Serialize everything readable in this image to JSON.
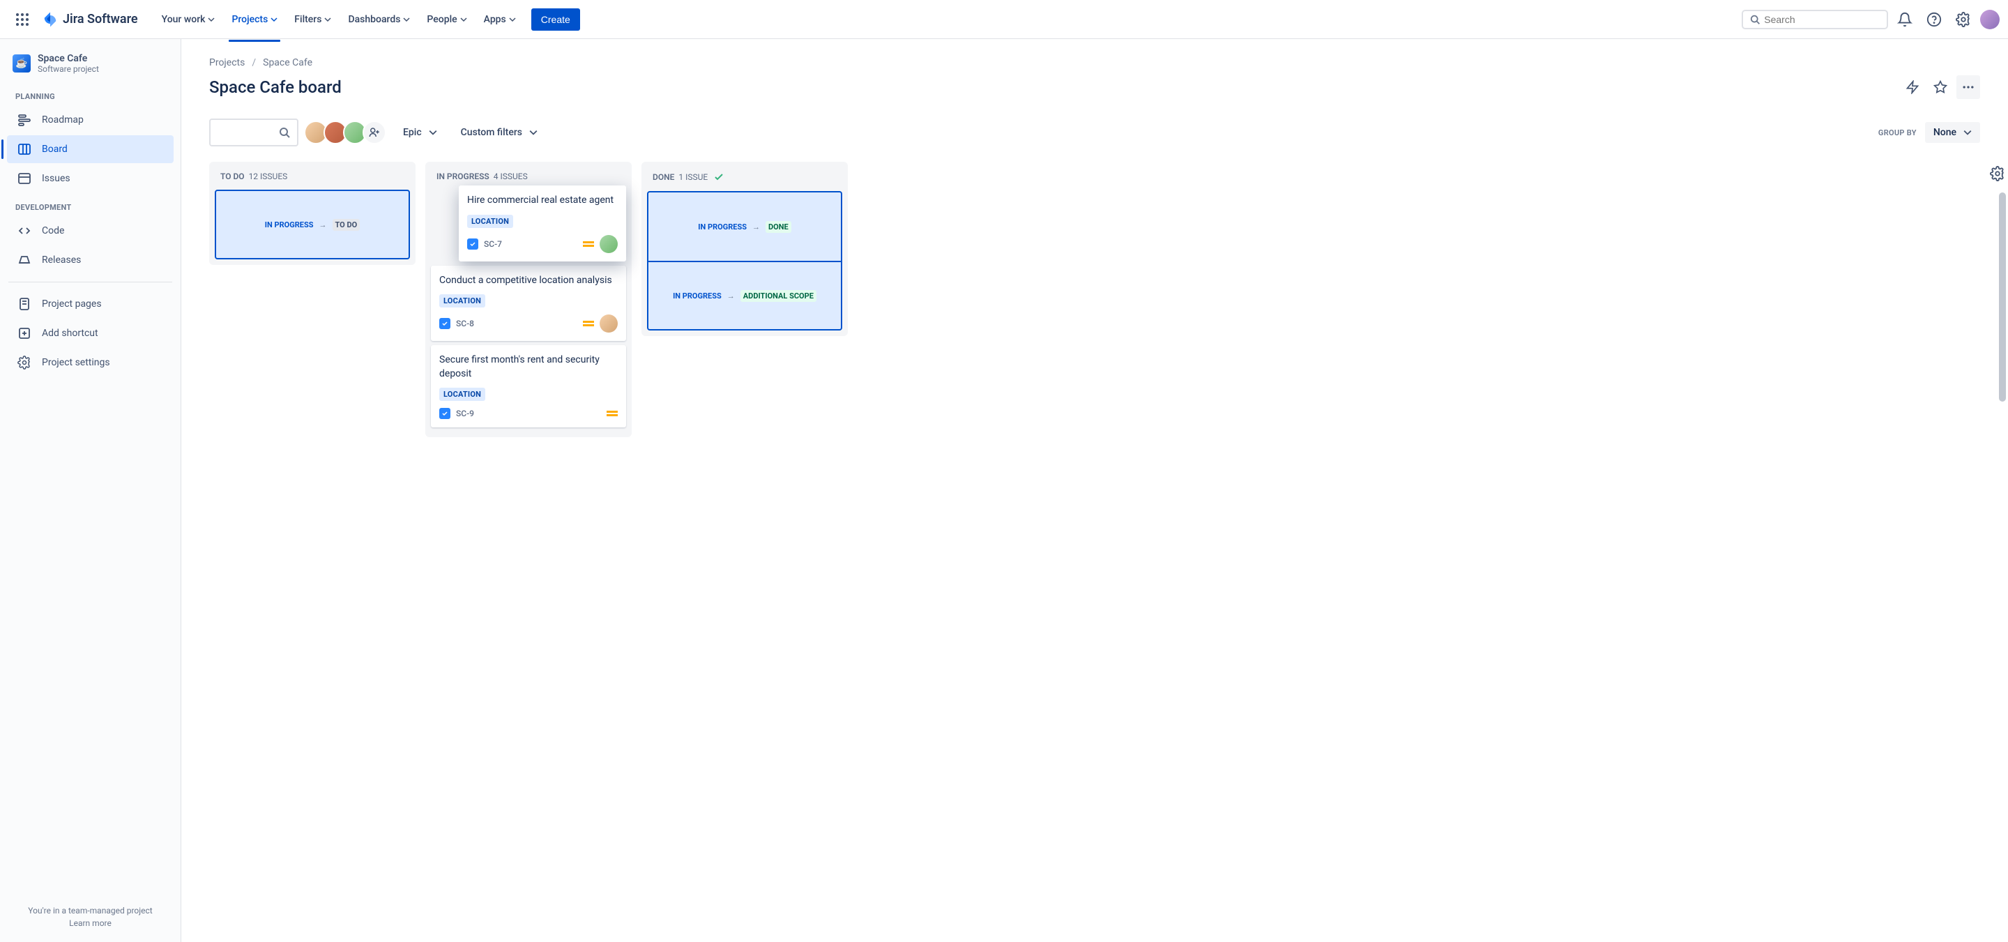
{
  "topnav": {
    "logo_text": "Jira Software",
    "items": [
      {
        "label": "Your work"
      },
      {
        "label": "Projects",
        "active": true
      },
      {
        "label": "Filters"
      },
      {
        "label": "Dashboards"
      },
      {
        "label": "People"
      },
      {
        "label": "Apps"
      }
    ],
    "create_label": "Create",
    "search_placeholder": "Search"
  },
  "sidebar": {
    "project_name": "Space Cafe",
    "project_sub": "Software project",
    "sections": {
      "planning_title": "PLANNING",
      "planning_items": [
        {
          "label": "Roadmap"
        },
        {
          "label": "Board",
          "active": true
        },
        {
          "label": "Issues"
        }
      ],
      "development_title": "DEVELOPMENT",
      "development_items": [
        {
          "label": "Code"
        },
        {
          "label": "Releases"
        }
      ],
      "extra_items": [
        {
          "label": "Project pages"
        },
        {
          "label": "Add shortcut"
        },
        {
          "label": "Project settings"
        }
      ]
    },
    "footer_line": "You're in a team-managed project",
    "footer_link": "Learn more"
  },
  "breadcrumb": {
    "item0": "Projects",
    "item1": "Space Cafe"
  },
  "page_title": "Space Cafe board",
  "filters": {
    "epic_label": "Epic",
    "custom_label": "Custom filters",
    "group_by_label": "GROUP BY",
    "group_by_value": "None"
  },
  "columns": {
    "todo": {
      "name": "TO DO",
      "count": "12 ISSUES"
    },
    "inprogress": {
      "name": "IN PROGRESS",
      "count": "4 ISSUES"
    },
    "done": {
      "name": "DONE",
      "count": "1 ISSUE"
    }
  },
  "transitions": {
    "from": "IN PROGRESS",
    "to_todo": "TO DO",
    "to_done": "DONE",
    "to_scope": "ADDITIONAL SCOPE"
  },
  "cards": {
    "c1": {
      "title": "Hire commercial real estate agent",
      "tag": "LOCATION",
      "key": "SC-7"
    },
    "c2": {
      "title": "Conduct a competitive location analysis",
      "tag": "LOCATION",
      "key": "SC-8"
    },
    "c3": {
      "title": "Secure first month's rent and security deposit",
      "tag": "LOCATION",
      "key": "SC-9"
    }
  }
}
